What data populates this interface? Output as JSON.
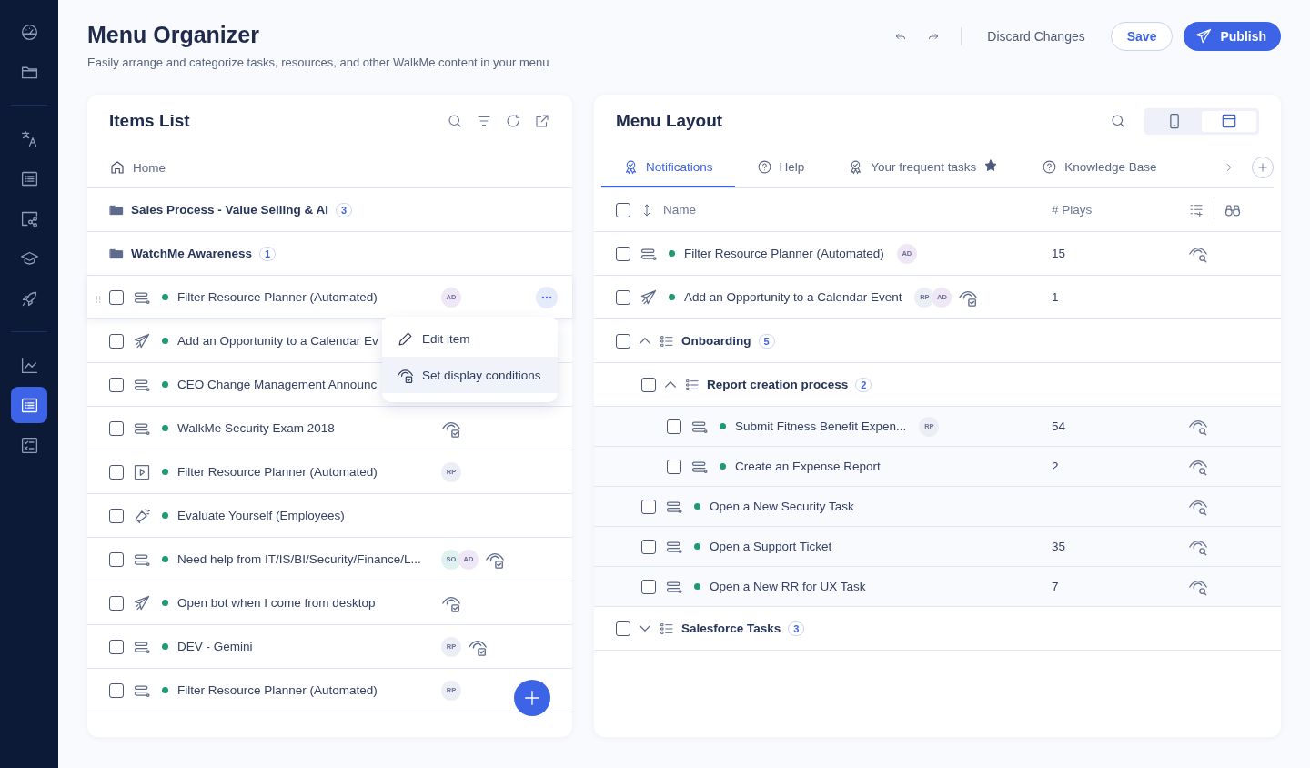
{
  "sidebar": {
    "items": [
      {
        "kind": "gauge",
        "selected": false
      },
      {
        "kind": "folder",
        "selected": false
      },
      {
        "kind": "divider"
      },
      {
        "kind": "translate",
        "selected": false
      },
      {
        "kind": "list",
        "selected": false
      },
      {
        "kind": "diagram",
        "selected": false
      },
      {
        "kind": "cap",
        "selected": false
      },
      {
        "kind": "rocket",
        "selected": false
      },
      {
        "kind": "divider"
      },
      {
        "kind": "chart",
        "selected": false
      },
      {
        "kind": "list",
        "selected": true
      },
      {
        "kind": "checklist",
        "selected": false
      }
    ]
  },
  "header": {
    "title": "Menu Organizer",
    "subtitle": "Easily arrange and categorize tasks, resources, and other WalkMe content in your menu",
    "discard": "Discard Changes",
    "save": "Save",
    "publish": "Publish"
  },
  "items_list": {
    "title": "Items List",
    "breadcrumb": "Home",
    "folders": [
      {
        "name": "Sales Process - Value Selling & AI",
        "count": "3"
      },
      {
        "name": "WatchMe Awareness",
        "count": "1"
      }
    ],
    "items": [
      {
        "kind": "flow",
        "name": "Filter Resource Planner (Automated)",
        "checked": false,
        "hovered": true,
        "avatars": [
          {
            "initials": "AD",
            "color": "#efe6f6"
          }
        ],
        "conditions": false
      },
      {
        "kind": "launcher",
        "name": "Add an Opportunity to a Calendar Ev",
        "checked": false,
        "hovered": false,
        "conditions": false
      },
      {
        "kind": "flow",
        "name": "CEO Change Management Announc",
        "checked": false,
        "hovered": false,
        "conditions": false
      },
      {
        "kind": "flow",
        "name": "WalkMe Security Exam 2018",
        "checked": false,
        "hovered": false,
        "conditions": true
      },
      {
        "kind": "video",
        "name": "Filter Resource Planner (Automated)",
        "checked": false,
        "hovered": false,
        "avatars": [
          {
            "initials": "RP",
            "color": "#eceef6"
          }
        ],
        "conditions": false
      },
      {
        "kind": "survey",
        "name": "Evaluate Yourself (Employees)",
        "checked": false,
        "hovered": false,
        "conditions": false
      },
      {
        "kind": "flow",
        "name": "Need help from IT/IS/BI/Security/Finance/L...",
        "checked": false,
        "hovered": false,
        "avatars": [
          {
            "initials": "SO",
            "color": "#e0f2ef"
          },
          {
            "initials": "AD",
            "color": "#efe6f6"
          }
        ],
        "conditions": true
      },
      {
        "kind": "launcher",
        "name": "Open bot when I come from desktop",
        "checked": false,
        "hovered": false,
        "conditions": true
      },
      {
        "kind": "flow",
        "name": "DEV - Gemini",
        "checked": false,
        "hovered": false,
        "avatars": [
          {
            "initials": "RP",
            "color": "#eceef6"
          }
        ],
        "conditions": true
      },
      {
        "kind": "flow",
        "name": "Filter Resource Planner (Automated)",
        "checked": false,
        "hovered": false,
        "avatars": [
          {
            "initials": "RP",
            "color": "#eceef6"
          }
        ],
        "conditions": false
      }
    ],
    "context_menu": [
      {
        "kind": "edit",
        "label": "Edit item",
        "selected": false
      },
      {
        "kind": "conditions",
        "label": "Set display conditions",
        "selected": true
      }
    ]
  },
  "menu_layout": {
    "title": "Menu Layout",
    "view_toggle": [
      {
        "kind": "mobile",
        "selected": false
      },
      {
        "kind": "desktop",
        "selected": true
      }
    ],
    "tabs": [
      {
        "kind": "badge",
        "label": "Notifications",
        "selected": true,
        "starred": false
      },
      {
        "kind": "help",
        "label": "Help",
        "selected": false,
        "starred": false
      },
      {
        "kind": "badge",
        "label": "Your frequent tasks",
        "selected": false,
        "starred": true
      },
      {
        "kind": "help",
        "label": "Knowledge Base",
        "selected": false,
        "starred": false
      }
    ],
    "columns": {
      "name": "Name",
      "plays": "# Plays"
    },
    "header_checked": false,
    "rows": [
      {
        "kind": "flow",
        "name": "Filter Resource Planner (Automated)",
        "checked": false,
        "avatars": [
          {
            "initials": "AD",
            "color": "#efe6f6"
          }
        ],
        "conditions": false,
        "plays": "15",
        "preview": true
      },
      {
        "kind": "launcher",
        "name": "Add an Opportunity to a Calendar Event",
        "checked": false,
        "avatars": [
          {
            "initials": "RP",
            "color": "#eceef6"
          },
          {
            "initials": "AD",
            "color": "#efe6f6"
          }
        ],
        "conditions": true,
        "plays": "1",
        "preview": false
      },
      {
        "kind": "group",
        "name": "Onboarding",
        "count": "5",
        "checked": false,
        "expanded": true,
        "children": [
          {
            "kind": "group",
            "name": "Report creation process",
            "count": "2",
            "checked": false,
            "expanded": true,
            "children": [
              {
                "kind": "flow",
                "name": "Submit Fitness Benefit Expen...",
                "checked": false,
                "avatars": [
                  {
                    "initials": "RP",
                    "color": "#eceef6"
                  }
                ],
                "conditions": false,
                "plays": "54",
                "preview": true
              },
              {
                "kind": "flow",
                "name": "Create an Expense Report",
                "checked": false,
                "conditions": false,
                "plays": "2",
                "preview": true
              }
            ]
          },
          {
            "kind": "flow",
            "name": "Open a New Security Task",
            "checked": false,
            "conditions": false,
            "preview": true
          },
          {
            "kind": "flow",
            "name": "Open a Support Ticket",
            "checked": false,
            "conditions": false,
            "plays": "35",
            "preview": true
          },
          {
            "kind": "flow",
            "name": "Open a New RR for UX Task",
            "checked": false,
            "conditions": false,
            "plays": "7",
            "preview": true
          }
        ]
      },
      {
        "kind": "group",
        "name": "Salesforce Tasks",
        "count": "3",
        "checked": false,
        "expanded": false
      }
    ]
  }
}
